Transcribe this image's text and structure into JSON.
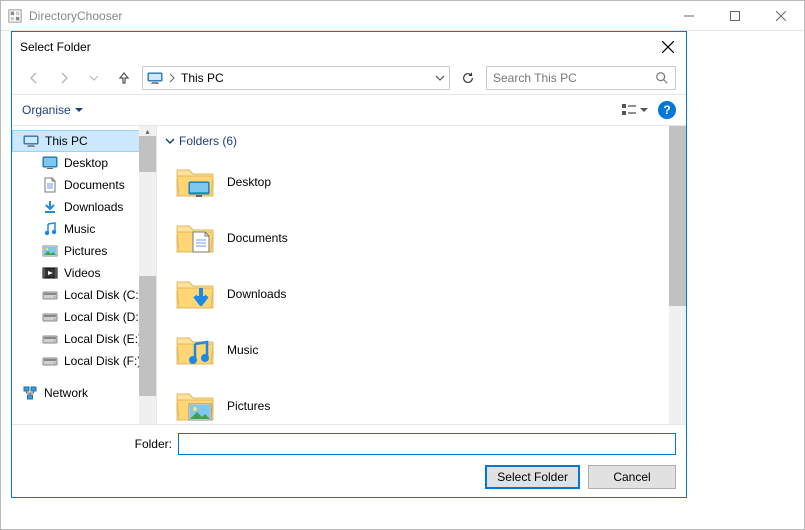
{
  "outer_window": {
    "title": "DirectoryChooser"
  },
  "dialog": {
    "title": "Select Folder",
    "address": {
      "location": "This PC"
    },
    "search": {
      "placeholder": "Search This PC"
    },
    "toolbar": {
      "organise": "Organise"
    },
    "tree": {
      "items": [
        {
          "label": "This PC",
          "icon": "pc",
          "selected": true,
          "depth": 0
        },
        {
          "label": "Desktop",
          "icon": "desktop",
          "depth": 1
        },
        {
          "label": "Documents",
          "icon": "documents",
          "depth": 1
        },
        {
          "label": "Downloads",
          "icon": "downloads",
          "depth": 1
        },
        {
          "label": "Music",
          "icon": "music",
          "depth": 1
        },
        {
          "label": "Pictures",
          "icon": "pictures",
          "depth": 1
        },
        {
          "label": "Videos",
          "icon": "videos",
          "depth": 1
        },
        {
          "label": "Local Disk (C:)",
          "icon": "disk",
          "depth": 1
        },
        {
          "label": "Local Disk (D:)",
          "icon": "disk",
          "depth": 1
        },
        {
          "label": "Local Disk (E:)",
          "icon": "disk",
          "depth": 1
        },
        {
          "label": "Local Disk (F:)",
          "icon": "disk",
          "depth": 1
        },
        {
          "label": "Network",
          "icon": "network",
          "depth": 0
        }
      ]
    },
    "list": {
      "group_label": "Folders (6)",
      "items": [
        {
          "label": "Desktop",
          "icon": "desktop"
        },
        {
          "label": "Documents",
          "icon": "documents"
        },
        {
          "label": "Downloads",
          "icon": "downloads"
        },
        {
          "label": "Music",
          "icon": "music"
        },
        {
          "label": "Pictures",
          "icon": "pictures"
        }
      ]
    },
    "footer": {
      "folder_label": "Folder:",
      "folder_value": "",
      "select_label": "Select Folder",
      "cancel_label": "Cancel"
    }
  }
}
